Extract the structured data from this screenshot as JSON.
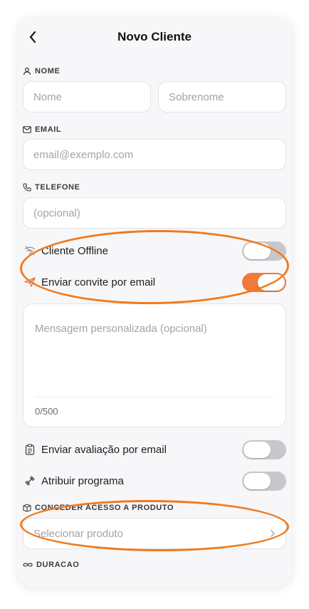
{
  "header": {
    "title": "Novo Cliente"
  },
  "name_section": {
    "label": "NOME",
    "first_name_placeholder": "Nome",
    "last_name_placeholder": "Sobrenome"
  },
  "email_section": {
    "label": "EMAIL",
    "placeholder": "email@exemplo.com"
  },
  "phone_section": {
    "label": "TELEFONE",
    "placeholder": "(opcional)"
  },
  "toggles": [
    {
      "label": "Cliente Offline",
      "icon": "wifi-off-icon",
      "on": false
    },
    {
      "label": "Enviar convite por email",
      "icon": "send-icon",
      "on": true
    }
  ],
  "message": {
    "placeholder": "Mensagem personalizada (opcional)",
    "counter": "0/500"
  },
  "extra_toggles": [
    {
      "label": "Enviar avaliação por email",
      "icon": "clipboard-icon",
      "on": false
    },
    {
      "label": "Atribuir programa",
      "icon": "dumbbell-icon",
      "on": false
    }
  ],
  "product_section": {
    "label": "CONCEDER ACESSO A PRODUTO",
    "placeholder": "Selecionar produto"
  },
  "duration_section": {
    "label": "DURACAO"
  },
  "colors": {
    "accent": "#f07a3a",
    "annotation": "#f07a1e",
    "toggle_off": "#c7c7cc"
  }
}
